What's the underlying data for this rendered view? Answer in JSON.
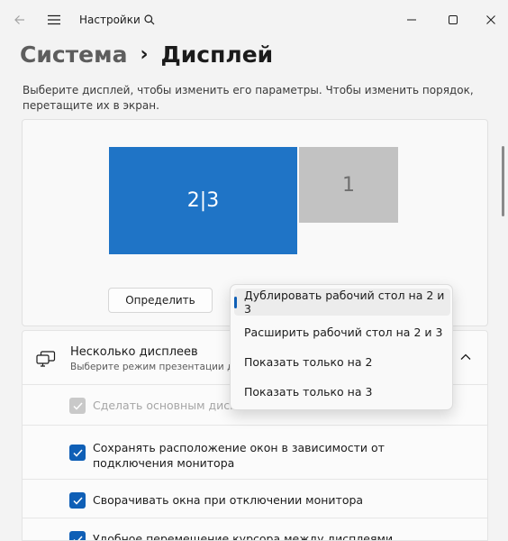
{
  "window": {
    "title": "Настройки"
  },
  "header": {
    "parent": "Система",
    "separator": "›",
    "current": "Дисплей"
  },
  "instructions": "Выберите дисплей, чтобы изменить его параметры. Чтобы изменить порядок, перетащите их в экран.",
  "arrangement": {
    "monitors": [
      {
        "label": "2|3",
        "color": "#1f74c6",
        "selected": true
      },
      {
        "label": "1",
        "color": "#c2c2c2",
        "selected": false
      }
    ],
    "identify_label": "Определить"
  },
  "dropdown": {
    "options": [
      {
        "label": "Дублировать рабочий стол на 2 и 3",
        "selected": true
      },
      {
        "label": "Расширить рабочий стол на 2 и 3",
        "selected": false
      },
      {
        "label": "Показать только на 2",
        "selected": false
      },
      {
        "label": "Показать только на 3",
        "selected": false
      }
    ]
  },
  "multiple_displays": {
    "title": "Несколько дисплеев",
    "subtitle": "Выберите режим презентации для д",
    "expanded": true,
    "options": [
      {
        "label": "Сделать основным дисплеем",
        "checked": true,
        "disabled": true
      },
      {
        "label": "Сохранять расположение окон в зависимости от подключения монитора",
        "checked": true,
        "disabled": false
      },
      {
        "label": "Сворачивать окна при отключении монитора",
        "checked": true,
        "disabled": false
      },
      {
        "label": "Удобное перемещение курсора между дисплеями",
        "checked": true,
        "disabled": false
      }
    ]
  },
  "colors": {
    "accent": "#0f5fb6",
    "background": "#f3f3f3"
  }
}
